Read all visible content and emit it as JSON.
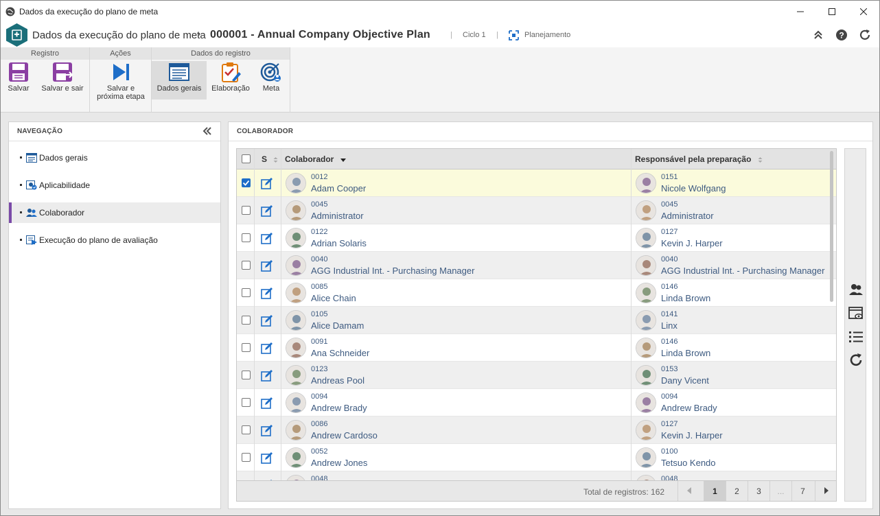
{
  "window": {
    "title": "Dados da execução do plano de meta"
  },
  "header": {
    "module": "Dados da execução do plano de meta",
    "separator": "›",
    "record": "000001 - Annual Company Objective Plan",
    "cycle": "Ciclo 1",
    "phase": "Planejamento"
  },
  "ribbon": {
    "groups": [
      {
        "title": "Registro"
      },
      {
        "title": "Ações"
      },
      {
        "title": "Dados do registro"
      }
    ],
    "buttons": {
      "save": "Salvar",
      "save_exit": "Salvar e sair",
      "save_next_1": "Salvar e",
      "save_next_2": "próxima etapa",
      "general": "Dados gerais",
      "elaboration": "Elaboração",
      "goal": "Meta"
    }
  },
  "nav": {
    "title": "NAVEGAÇÃO",
    "items": [
      {
        "label": "Dados gerais"
      },
      {
        "label": "Aplicabilidade"
      },
      {
        "label": "Colaborador"
      },
      {
        "label": "Execução do plano de avaliação"
      }
    ]
  },
  "main": {
    "title": "COLABORADOR",
    "columns": {
      "s": "S",
      "employee": "Colaborador",
      "responsible": "Responsável pela preparação"
    },
    "rows": [
      {
        "code": "0012",
        "name": "Adam Cooper",
        "rcode": "0151",
        "rname": "Nicole Wolfgang",
        "checked": true
      },
      {
        "code": "0045",
        "name": "Administrator",
        "rcode": "0045",
        "rname": "Administrator",
        "checked": false
      },
      {
        "code": "0122",
        "name": "Adrian Solaris",
        "rcode": "0127",
        "rname": "Kevin J. Harper",
        "checked": false
      },
      {
        "code": "0040",
        "name": "AGG Industrial Int. - Purchasing Manager",
        "rcode": "0040",
        "rname": "AGG Industrial Int. - Purchasing Manager",
        "checked": false
      },
      {
        "code": "0085",
        "name": "Alice Chain",
        "rcode": "0146",
        "rname": "Linda Brown",
        "checked": false
      },
      {
        "code": "0105",
        "name": "Alice Damam",
        "rcode": "0141",
        "rname": "Linx",
        "checked": false
      },
      {
        "code": "0091",
        "name": "Ana Schneider",
        "rcode": "0146",
        "rname": "Linda Brown",
        "checked": false
      },
      {
        "code": "0123",
        "name": "Andreas Pool",
        "rcode": "0153",
        "rname": "Dany Vicent",
        "checked": false
      },
      {
        "code": "0094",
        "name": "Andrew Brady",
        "rcode": "0094",
        "rname": "Andrew Brady",
        "checked": false
      },
      {
        "code": "0086",
        "name": "Andrew Cardoso",
        "rcode": "0127",
        "rname": "Kevin J. Harper",
        "checked": false
      },
      {
        "code": "0052",
        "name": "Andrew Jones",
        "rcode": "0100",
        "rname": "Tetsuo Kendo",
        "checked": false
      },
      {
        "code": "0048",
        "name": "",
        "rcode": "0048",
        "rname": "",
        "checked": false
      }
    ],
    "footer": {
      "total_label": "Total de registros: 162",
      "pages": [
        "1",
        "2",
        "3",
        "...",
        "7"
      ],
      "current_page": "1"
    }
  },
  "colors": {
    "accent_purple": "#7a4aa8",
    "link_blue": "#3d5a80",
    "icon_blue": "#1e6ec8",
    "selected_row": "#fbfbdc"
  }
}
